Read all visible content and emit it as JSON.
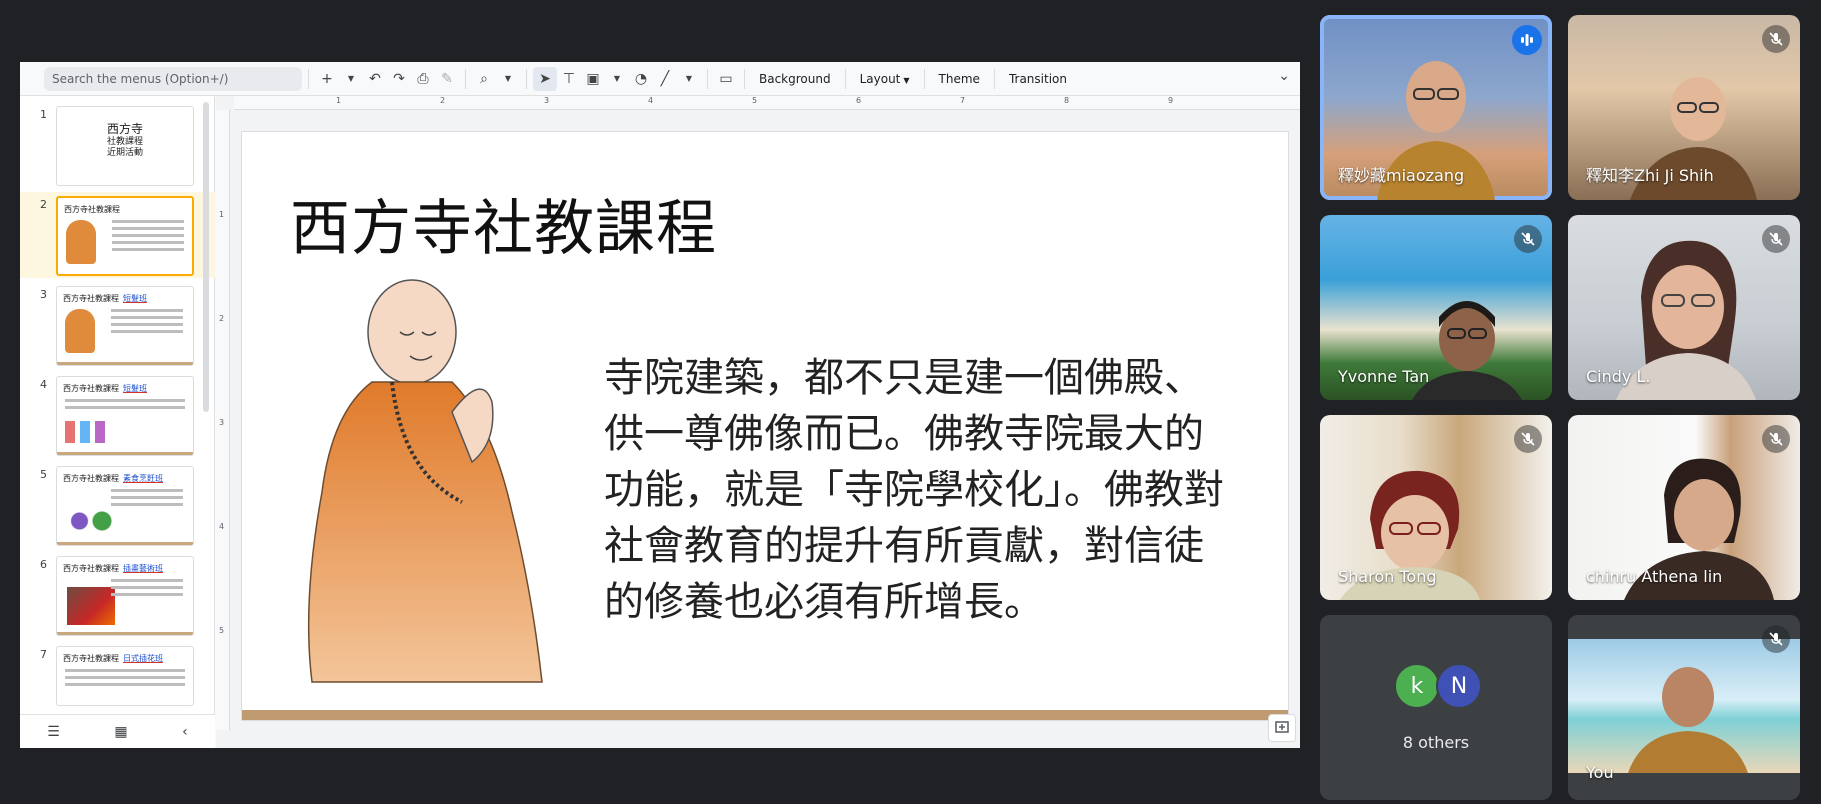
{
  "toolbar": {
    "search_placeholder": "Search the menus (Option+/)",
    "background_label": "Background",
    "layout_label": "Layout",
    "theme_label": "Theme",
    "transition_label": "Transition"
  },
  "ruler": {
    "h_marks": [
      "1",
      "2",
      "3",
      "4",
      "5",
      "6",
      "7",
      "8",
      "9"
    ],
    "v_marks": [
      "1",
      "2",
      "3",
      "4",
      "5"
    ]
  },
  "thumbnails": [
    {
      "num": "1",
      "lines": [
        "西方寺",
        "社教課程",
        "近期活動"
      ]
    },
    {
      "num": "2",
      "title": "西方寺社教課程",
      "tag": ""
    },
    {
      "num": "3",
      "title": "西方寺社教課程",
      "tag": "短髮班"
    },
    {
      "num": "4",
      "title": "西方寺社教課程",
      "tag": "短髮班"
    },
    {
      "num": "5",
      "title": "西方寺社教課程",
      "tag": "素食烹飪班"
    },
    {
      "num": "6",
      "title": "西方寺社教課程",
      "tag": "插畫藝術班"
    },
    {
      "num": "7",
      "title": "西方寺社教課程",
      "tag": "日式插花班"
    }
  ],
  "slide": {
    "title": "西方寺社教課程",
    "body": "寺院建築，都不只是建一個佛殿、供一尊佛像而已。佛教寺院最大的功能，就是「寺院學校化」。佛教對社會教育的提升有所貢獻，對信徒的修養也必須有所增長。"
  },
  "participants": [
    {
      "name": "釋妙藏miaozang",
      "speaking": true,
      "muted": false
    },
    {
      "name": "釋知李Zhi Ji Shih",
      "speaking": false,
      "muted": true
    },
    {
      "name": "Yvonne Tan",
      "speaking": false,
      "muted": true
    },
    {
      "name": "Cindy L.",
      "speaking": false,
      "muted": true
    },
    {
      "name": "Sharon Tong",
      "speaking": false,
      "muted": true
    },
    {
      "name": "chinru Athena lin",
      "speaking": false,
      "muted": true
    },
    {
      "name": "You",
      "speaking": false,
      "muted": true
    }
  ],
  "others": {
    "avatars": [
      "k",
      "N"
    ],
    "avatar_colors": [
      "#4caf50",
      "#3f51b5"
    ],
    "label": "8 others"
  }
}
